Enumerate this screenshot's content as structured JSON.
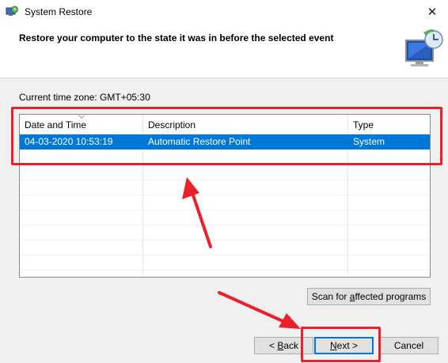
{
  "window": {
    "title": "System Restore",
    "close_glyph": "✕"
  },
  "header": {
    "text": "Restore your computer to the state it was in before the selected event",
    "icon": "system-restore-icon"
  },
  "timezone_label": "Current time zone: GMT+05:30",
  "list": {
    "columns": [
      "Date and Time",
      "Description",
      "Type"
    ],
    "rows": [
      {
        "date": "04-03-2020 10:53:19",
        "description": "Automatic Restore Point",
        "type": "System",
        "selected": true
      }
    ]
  },
  "buttons": {
    "scan_pre": "Scan for ",
    "scan_underlined": "a",
    "scan_post": "ffected programs",
    "back_pre": "< ",
    "back_underlined": "B",
    "back_post": "ack",
    "next_underlined": "N",
    "next_post": "ext >",
    "cancel": "Cancel"
  },
  "colors": {
    "selection": "#0078d7",
    "annotation_red": "#e8212b"
  }
}
